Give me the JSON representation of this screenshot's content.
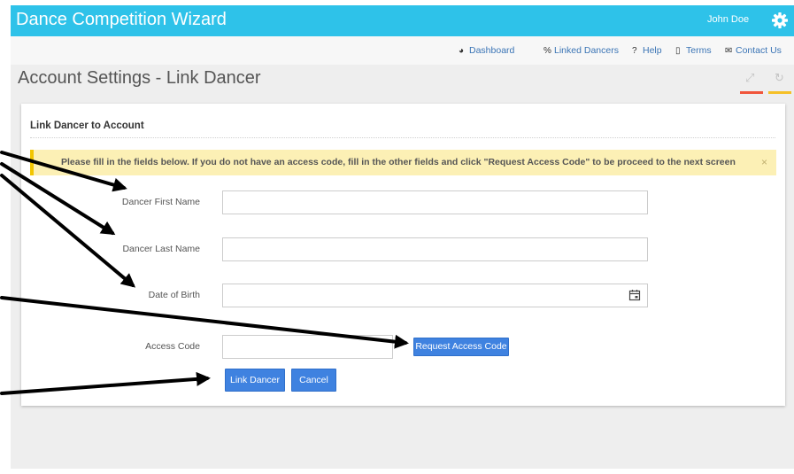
{
  "app": {
    "title": "Dance Competition Wizard",
    "user_name": "John Doe",
    "accent_color": "#2ec2e9"
  },
  "nav": [
    {
      "icon": "dashboard-icon",
      "label": "Dashboard"
    },
    {
      "icon": "link-icon",
      "label": "Linked Dancers"
    },
    {
      "icon": "help-icon",
      "label": "Help"
    },
    {
      "icon": "document-icon",
      "label": "Terms"
    },
    {
      "icon": "envelope-icon",
      "label": "Contact Us"
    }
  ],
  "page": {
    "title": "Account Settings - Link Dancer",
    "header_icons": [
      "expand-icon",
      "refresh-icon"
    ]
  },
  "panel": {
    "title": "Link Dancer to Account",
    "alert": "Please fill in the fields below. If you do not have an access code, fill in the other fields and click \"Request Access Code\" to be proceed to the next screen",
    "alert_close": "×"
  },
  "form": {
    "first_name": {
      "label": "Dancer First Name",
      "value": ""
    },
    "last_name": {
      "label": "Dancer Last Name",
      "value": ""
    },
    "dob": {
      "label": "Date of Birth",
      "value": ""
    },
    "access_code": {
      "label": "Access Code",
      "value": ""
    }
  },
  "buttons": {
    "request": "Request Access Code",
    "link": "Link Dancer",
    "cancel": "Cancel"
  }
}
